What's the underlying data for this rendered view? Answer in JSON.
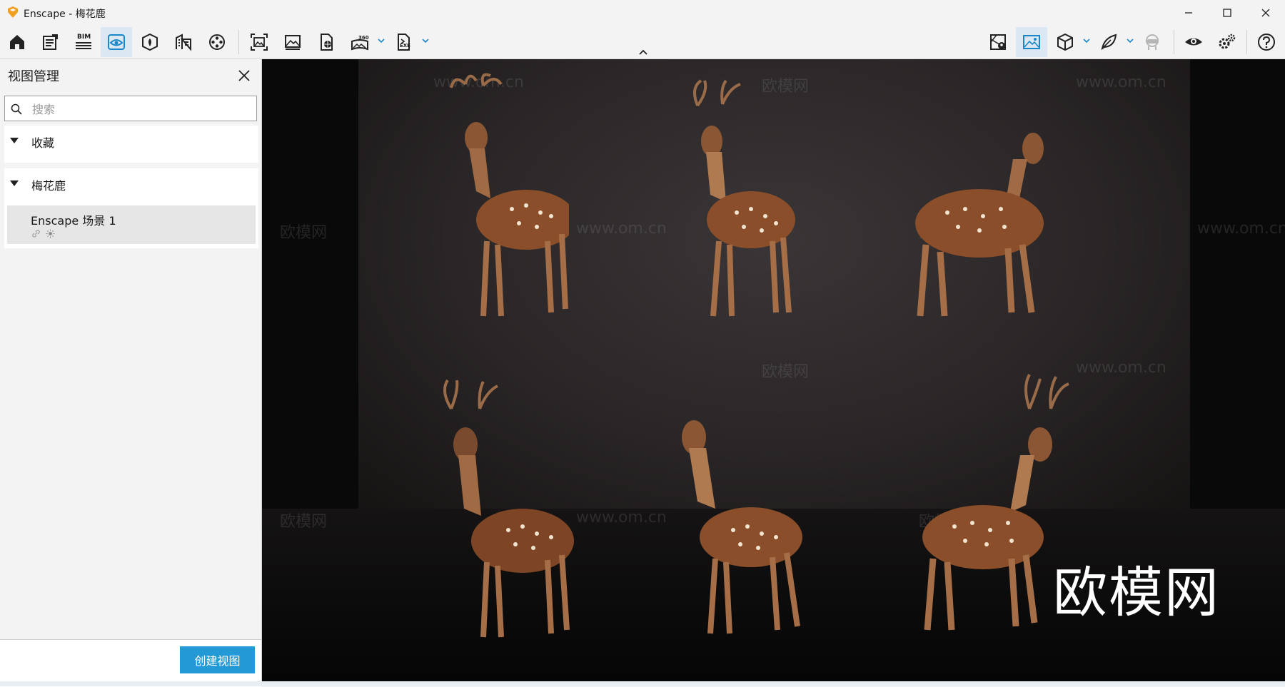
{
  "window": {
    "title": "Enscape - 梅花鹿"
  },
  "toolbar": {
    "bim_label": "BIM",
    "left_buttons": [
      "home-icon",
      "view-management-icon",
      "bim-icon",
      "visual-settings-icon",
      "asset-library-icon",
      "material-editor-icon",
      "video-editor-icon"
    ],
    "capture_buttons": [
      "screenshot-icon",
      "batch-render-icon",
      "web-standalone-icon",
      "panorama-360-icon",
      "exe-export-icon"
    ],
    "right_buttons": [
      "minimap-icon",
      "viewport-visibility-icon",
      "cube-view-icon",
      "feather-icon",
      "vr-headset-icon",
      "eye-visibility-icon",
      "settings-gears-icon",
      "help-icon"
    ]
  },
  "panel": {
    "title": "视图管理",
    "search_placeholder": "搜索",
    "favorites_label": "收藏",
    "group_label": "梅花鹿",
    "view_item_name": "Enscape 场景 1",
    "create_button": "创建视图"
  },
  "viewport": {
    "watermark_text": "欧模网",
    "faint_watermark_brand": "欧模网",
    "faint_watermark_url": "www.om.cn"
  },
  "colors": {
    "accent": "#2399d6",
    "active_tool_bg": "#dbe8f3",
    "panel_bg": "#f3f3f3",
    "deer_body": "#8a4f2a"
  }
}
